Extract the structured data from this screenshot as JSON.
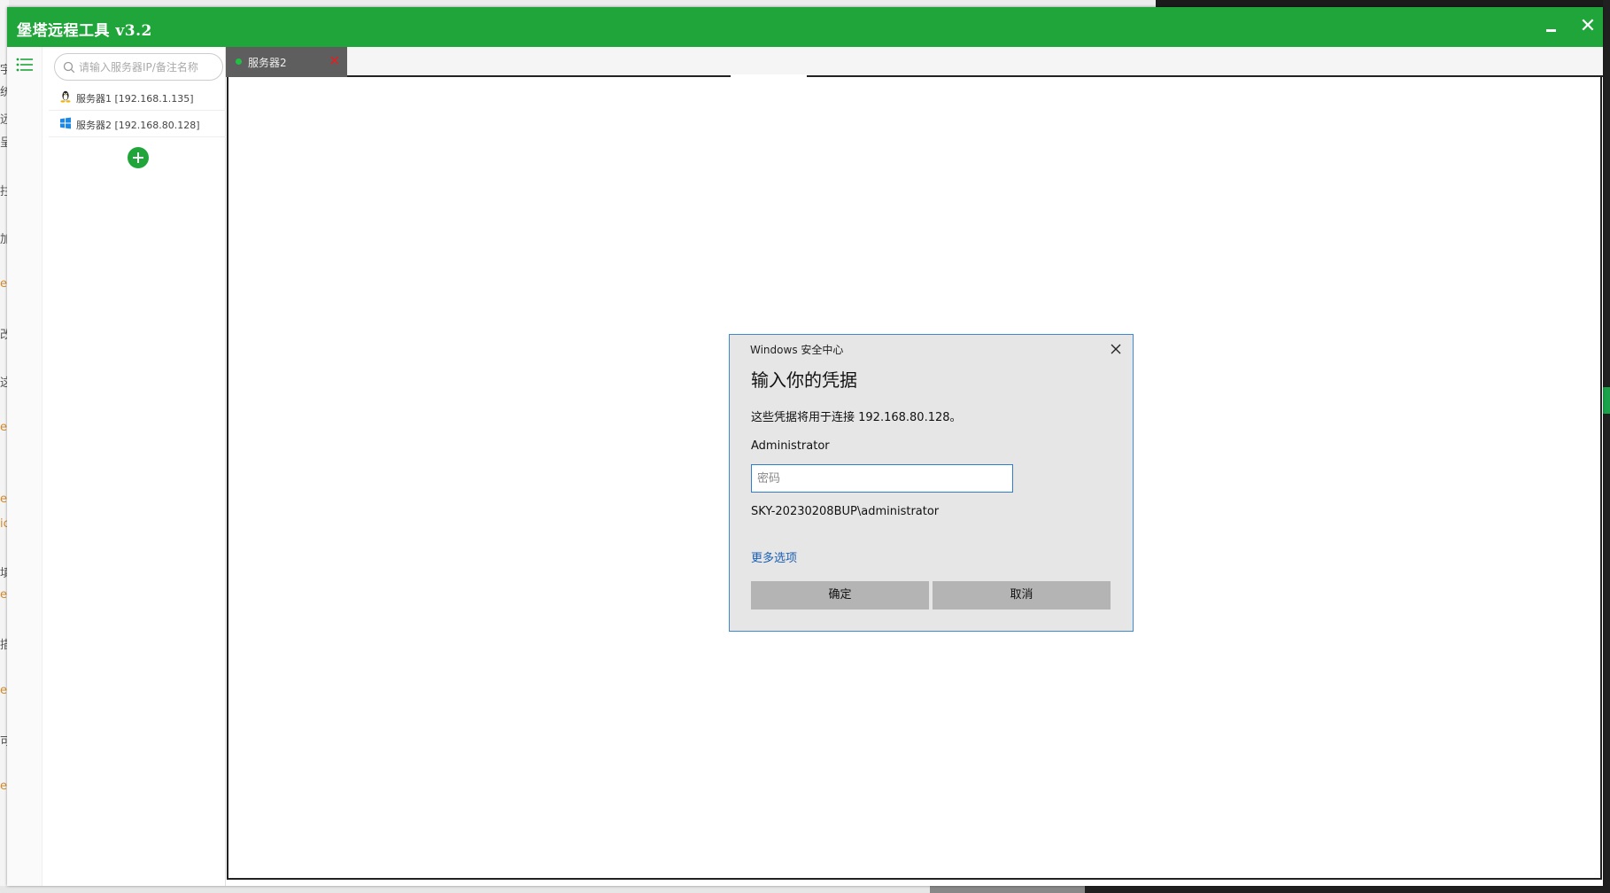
{
  "app": {
    "title": "堡塔远程工具 v3.2",
    "minimize_icon": "minimize-icon",
    "close_icon": "close-icon",
    "accent_color": "#20a53a"
  },
  "backdrop": {
    "left_strip_chars": [
      "宇",
      "统",
      "远",
      "呈",
      "拄",
      "加",
      "e",
      "改",
      "这",
      "e",
      "e",
      "ic",
      "填",
      "e",
      "描",
      "ee",
      "可",
      "e"
    ]
  },
  "sidebar": {
    "menu_icon": "list-icon",
    "search": {
      "placeholder": "请输入服务器IP/备注名称",
      "value": "",
      "icon": "search-icon"
    },
    "servers": [
      {
        "label": "服务器1 [192.168.1.135]",
        "os_icon": "linux-icon"
      },
      {
        "label": "服务器2 [192.168.80.128]",
        "os_icon": "windows-icon"
      }
    ],
    "add_icon": "plus-circle-icon"
  },
  "tabs": [
    {
      "label": "服务器2",
      "status_color": "#20c045",
      "close_icon": "close-icon",
      "close_color": "#e02020",
      "active": true
    }
  ],
  "dialog": {
    "caption": "Windows 安全中心",
    "heading": "输入你的凭据",
    "description": "这些凭据将用于连接 192.168.80.128。",
    "username": "Administrator",
    "password": {
      "placeholder": "密码",
      "value": ""
    },
    "domain_user": "SKY-20230208BUP\\administrator",
    "more_options": "更多选项",
    "ok_label": "确定",
    "cancel_label": "取消",
    "border_color": "#3c8ad6"
  }
}
